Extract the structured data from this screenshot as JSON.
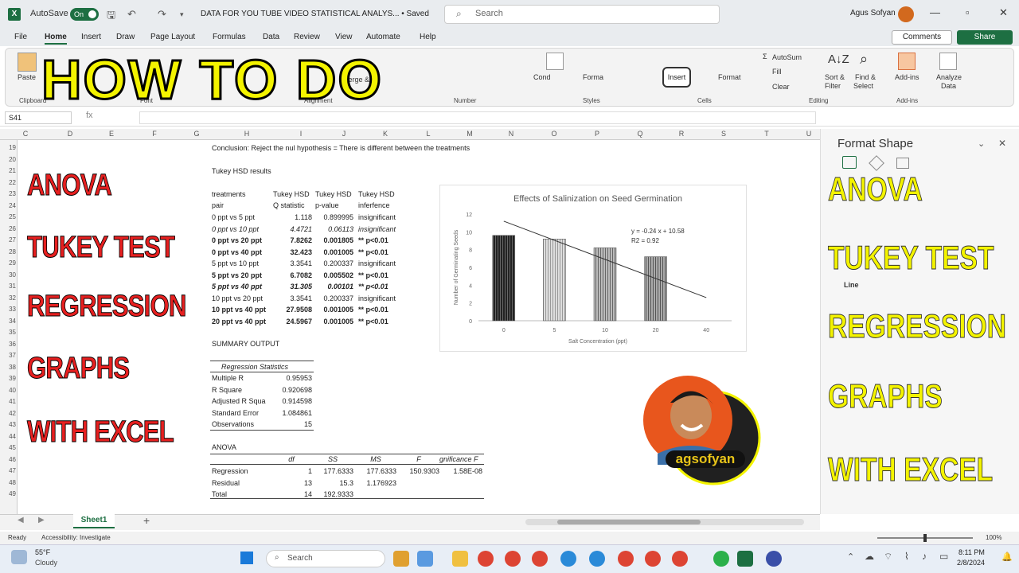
{
  "app": {
    "autosave_label": "AutoSave",
    "autosave_state": "On",
    "doc_title": "DATA FOR YOU TUBE VIDEO STATISTICAL ANALYS... • Saved",
    "search_placeholder": "Search",
    "user_name": "Agus Sofyan"
  },
  "menu": [
    "File",
    "Home",
    "Insert",
    "Draw",
    "Page Layout",
    "Formulas",
    "Data",
    "Review",
    "View",
    "Automate",
    "Help"
  ],
  "menu_active": "Home",
  "comments_label": "Comments",
  "share_label": "Share",
  "ribbon": {
    "paste": "Paste",
    "clipboard": "Clipboard",
    "font": "Font",
    "alignment": "Alignment",
    "merge": "Merge &",
    "number": "Number",
    "cond": "Cond",
    "format": "Forma",
    "styles": "Styles",
    "insert": "Insert",
    "format2": "Format",
    "cells": "Cells",
    "autosum": "AutoSum",
    "fill": "Fill",
    "clear": "Clear",
    "sort": "Sort &",
    "filter": "Filter",
    "find": "Find &",
    "select": "Select",
    "editing": "Editing",
    "addins": "Add-ins",
    "addins_group": "Add-ins",
    "analyze": "Analyze",
    "data_label": "Data"
  },
  "overlay_title": "HOW TO DO",
  "name_box": "S41",
  "fx": "fx",
  "columns": [
    "C",
    "D",
    "E",
    "F",
    "G",
    "H",
    "I",
    "J",
    "K",
    "L",
    "M",
    "N",
    "O",
    "P",
    "Q",
    "R",
    "S",
    "T",
    "U"
  ],
  "rows": [
    "19",
    "20",
    "21",
    "22",
    "23",
    "24",
    "25",
    "26",
    "27",
    "28",
    "29",
    "30",
    "31",
    "32",
    "33",
    "34",
    "35",
    "36",
    "37",
    "38",
    "39",
    "40",
    "41",
    "42",
    "43",
    "44",
    "45",
    "46",
    "47",
    "48",
    "49"
  ],
  "sheet": {
    "conclusion": "Conclusion: Reject the nul hypothesis = There is different between the treatments",
    "tukey_title": "Tukey HSD results",
    "th_treat": "treatments",
    "th_pair": "pair",
    "th_q1": "Tukey HSD",
    "th_q2": "Q statistic",
    "th_p1": "Tukey HSD",
    "th_p2": "p-value",
    "th_i1": "Tukey HSD",
    "th_i2": "inferfence",
    "tukey_rows": [
      {
        "pair": "0 ppt vs 5 ppt",
        "q": "1.118",
        "p": "0.899995",
        "inf": "insignificant",
        "style": ""
      },
      {
        "pair": "0 ppt vs 10 ppt",
        "q": "4.4721",
        "p": "0.06113",
        "inf": "insignificant",
        "style": "i"
      },
      {
        "pair": "0 ppt vs 20 ppt",
        "q": "7.8262",
        "p": "0.001805",
        "inf": "** p<0.01",
        "style": "b"
      },
      {
        "pair": "0 ppt vs 40 ppt",
        "q": "32.423",
        "p": "0.001005",
        "inf": "** p<0.01",
        "style": "b"
      },
      {
        "pair": "5 ppt vs 10 ppt",
        "q": "3.3541",
        "p": "0.200337",
        "inf": "insignificant",
        "style": ""
      },
      {
        "pair": "5 ppt vs 20 ppt",
        "q": "6.7082",
        "p": "0.005502",
        "inf": "** p<0.01",
        "style": "b"
      },
      {
        "pair": "5 ppt vs 40 ppt",
        "q": "31.305",
        "p": "0.00101",
        "inf": "** p<0.01",
        "style": "bi"
      },
      {
        "pair": "10 ppt vs 20 ppt",
        "q": "3.3541",
        "p": "0.200337",
        "inf": "insignificant",
        "style": ""
      },
      {
        "pair": "10 ppt vs 40 ppt",
        "q": "27.9508",
        "p": "0.001005",
        "inf": "** p<0.01",
        "style": "b"
      },
      {
        "pair": "20 ppt vs 40 ppt",
        "q": "24.5967",
        "p": "0.001005",
        "inf": "** p<0.01",
        "style": "b"
      }
    ],
    "summary_output": "SUMMARY OUTPUT",
    "regression_stats": "Regression Statistics",
    "reg_rows": [
      {
        "label": "Multiple R",
        "value": "0.95953"
      },
      {
        "label": "R Square",
        "value": "0.920698"
      },
      {
        "label": "Adjusted R Squa",
        "value": "0.914598"
      },
      {
        "label": "Standard Error",
        "value": "1.084861"
      },
      {
        "label": "Observations",
        "value": "15"
      }
    ],
    "anova": "ANOVA",
    "anova_headers": [
      "df",
      "SS",
      "MS",
      "F",
      "gnificance F"
    ],
    "anova_rows": [
      {
        "label": "Regression",
        "df": "1",
        "ss": "177.6333",
        "ms": "177.6333",
        "f": "150.9303",
        "sig": "1.58E-08"
      },
      {
        "label": "Residual",
        "df": "13",
        "ss": "15.3",
        "ms": "1.176923",
        "f": "",
        "sig": ""
      },
      {
        "label": "Total",
        "df": "14",
        "ss": "192.9333",
        "ms": "",
        "f": "",
        "sig": ""
      }
    ]
  },
  "left_overlay": [
    "ANOVA",
    "TUKEY TEST",
    "REGRESSION",
    "GRAPHS",
    "WITH EXCEL"
  ],
  "right_overlay": [
    "ANOVA",
    "TUKEY TEST",
    "REGRESSION",
    "GRAPHS",
    "WITH EXCEL"
  ],
  "format_panel": {
    "title": "Format Shape",
    "line_label": "Line"
  },
  "avatar_brand": "agsofyan",
  "chart_data": {
    "type": "bar",
    "title": "Effects of Salinization on Seed Germination",
    "xlabel": "Salt Concentration (ppt)",
    "ylabel": "Number of Germinating Seeds",
    "categories": [
      "0",
      "5",
      "10",
      "20",
      "40"
    ],
    "values": [
      9.6,
      9.2,
      8.2,
      7.2,
      0
    ],
    "ylim": [
      0,
      12
    ],
    "yticks": [
      "0",
      "2",
      "4",
      "6",
      "8",
      "10",
      "12"
    ],
    "trendline": {
      "slope": -0.24,
      "intercept": 10.58
    },
    "equation": "y = -0.24 x + 10.58",
    "r2": "R2 = 0.92",
    "grid": false
  },
  "sheet_tab": "Sheet1",
  "status": {
    "ready": "Ready",
    "accessibility": "Accessibility: Investigate",
    "zoom": "100%"
  },
  "taskbar": {
    "temp": "55°F",
    "weather": "Cloudy",
    "search": "Search",
    "time": "8:11 PM",
    "date": "2/8/2024"
  },
  "colors": {
    "excel_green": "#1d6f42",
    "overlay_yellow": "#f3f300",
    "overlay_red": "#e62020"
  }
}
